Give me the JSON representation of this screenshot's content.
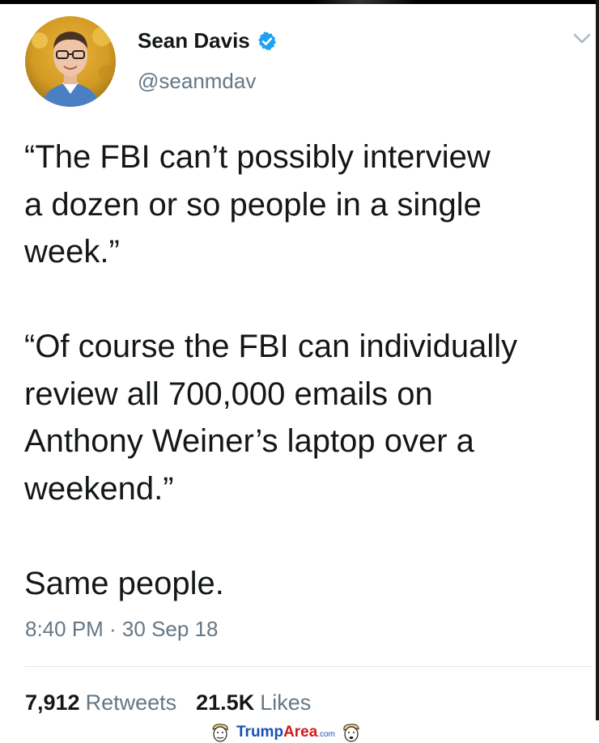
{
  "tweet": {
    "display_name": "Sean Davis",
    "handle": "@seanmdav",
    "verified": true,
    "text": "“The FBI can’t possibly interview\na dozen or so people in a single\nweek.”\n\n“Of course the FBI can individually\nreview all 700,000 emails on\nAnthony Weiner’s laptop over a\nweekend.”\n\nSame people.",
    "timestamp": "8:40 PM · 30 Sep 18",
    "retweets_count": "7,912",
    "retweets_label": "Retweets",
    "likes_count": "21.5K",
    "likes_label": "Likes"
  },
  "watermark": {
    "brand_part1": "Trump",
    "brand_part2": "Area",
    "brand_suffix": ".com"
  },
  "colors": {
    "text": "#14171a",
    "secondary": "#657786",
    "verified": "#1da1f2",
    "divider": "#e1e8ed"
  }
}
